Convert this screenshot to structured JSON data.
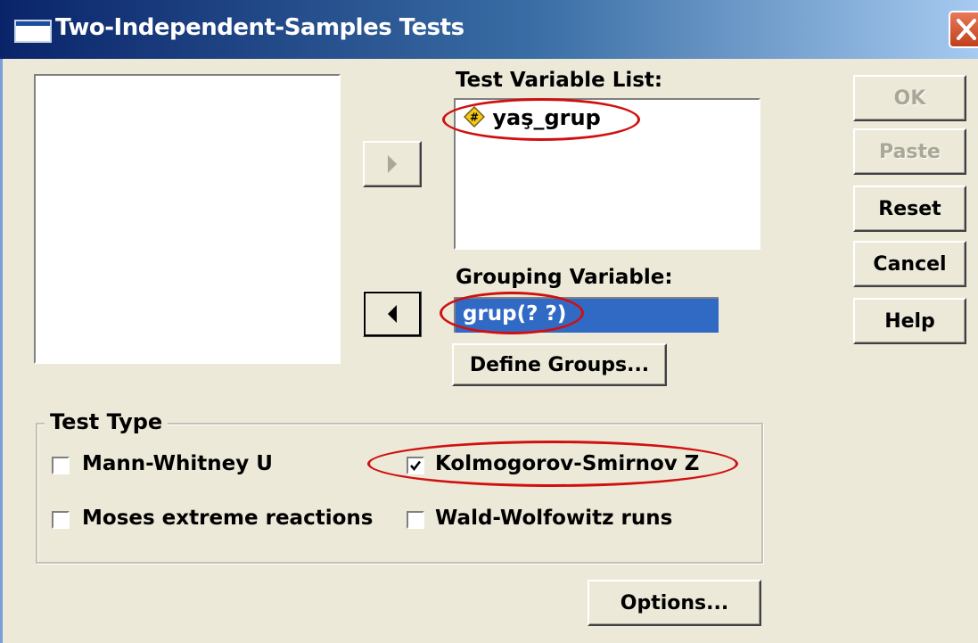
{
  "window": {
    "title": "Two-Independent-Samples Tests"
  },
  "test_variable_list": {
    "label": "Test Variable List:",
    "items": [
      {
        "name": "yaş_grup",
        "icon": "numeric-variable-icon"
      }
    ]
  },
  "grouping_variable": {
    "label": "Grouping Variable:",
    "value": "grup(? ?)"
  },
  "buttons": {
    "ok": "OK",
    "paste": "Paste",
    "reset": "Reset",
    "cancel": "Cancel",
    "help": "Help",
    "define_groups": "Define Groups...",
    "options": "Options..."
  },
  "test_type": {
    "title": "Test Type",
    "options": [
      {
        "label": "Mann-Whitney U",
        "checked": false
      },
      {
        "label": "Kolmogorov-Smirnov Z",
        "checked": true
      },
      {
        "label": "Moses extreme reactions",
        "checked": false
      },
      {
        "label": "Wald-Wolfowitz runs",
        "checked": false
      }
    ]
  },
  "colors": {
    "dialog_bg": "#ece9d8",
    "title_bar": "#0a246a",
    "selection": "#316ac5",
    "annotation": "#d01010"
  }
}
